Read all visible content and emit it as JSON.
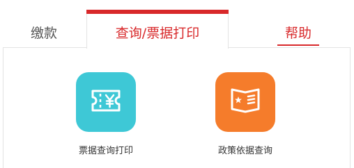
{
  "tabs": {
    "pay_label": "缴款",
    "query_label": "查询/票据打印",
    "help_label": "帮助"
  },
  "services": [
    {
      "label": "票据查询打印",
      "icon": "ticket-yuan-icon",
      "color": "#3ec8d6"
    },
    {
      "label": "政策依据查询",
      "icon": "policy-book-icon",
      "color": "#f57c2b"
    }
  ],
  "colors": {
    "accent": "#d8282a",
    "tab_inactive_text": "#555555",
    "border": "#e3e3e3"
  }
}
